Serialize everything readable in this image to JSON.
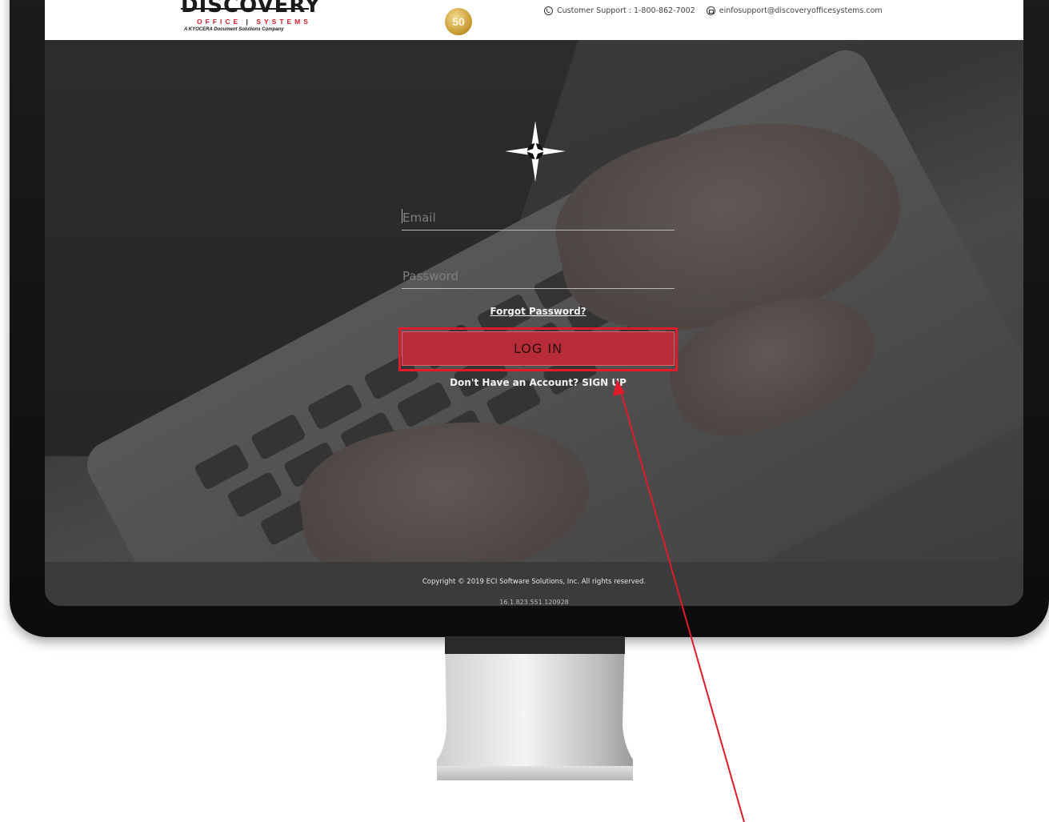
{
  "header": {
    "logo_word": "DISCOVERY",
    "logo_sub_left": "OFFICE",
    "logo_sub_divider": "|",
    "logo_sub_right": "SYSTEMS",
    "logo_tagline": "A KYOCERA Document Solutions Company",
    "badge_text": "50",
    "support_label": "Customer Support : 1-800-862-7002",
    "email_label": "einfosupport@discoveryofficesystems.com",
    "phone_icon": "phone-icon",
    "email_icon": "email-icon"
  },
  "login": {
    "email_placeholder": "Email",
    "password_placeholder": "Password",
    "forgot_label": "Forgot Password?",
    "login_label": "LOG IN",
    "signup_label": "Don't Have an Account? SIGN UP"
  },
  "footer": {
    "copyright": "Copyright © 2019 ECI Software Solutions, Inc. All rights reserved.",
    "version": "16.1.823.551.120928"
  },
  "colors": {
    "accent": "#b82c3a",
    "highlight": "#e01b2b",
    "arrow": "#e01b2b"
  }
}
